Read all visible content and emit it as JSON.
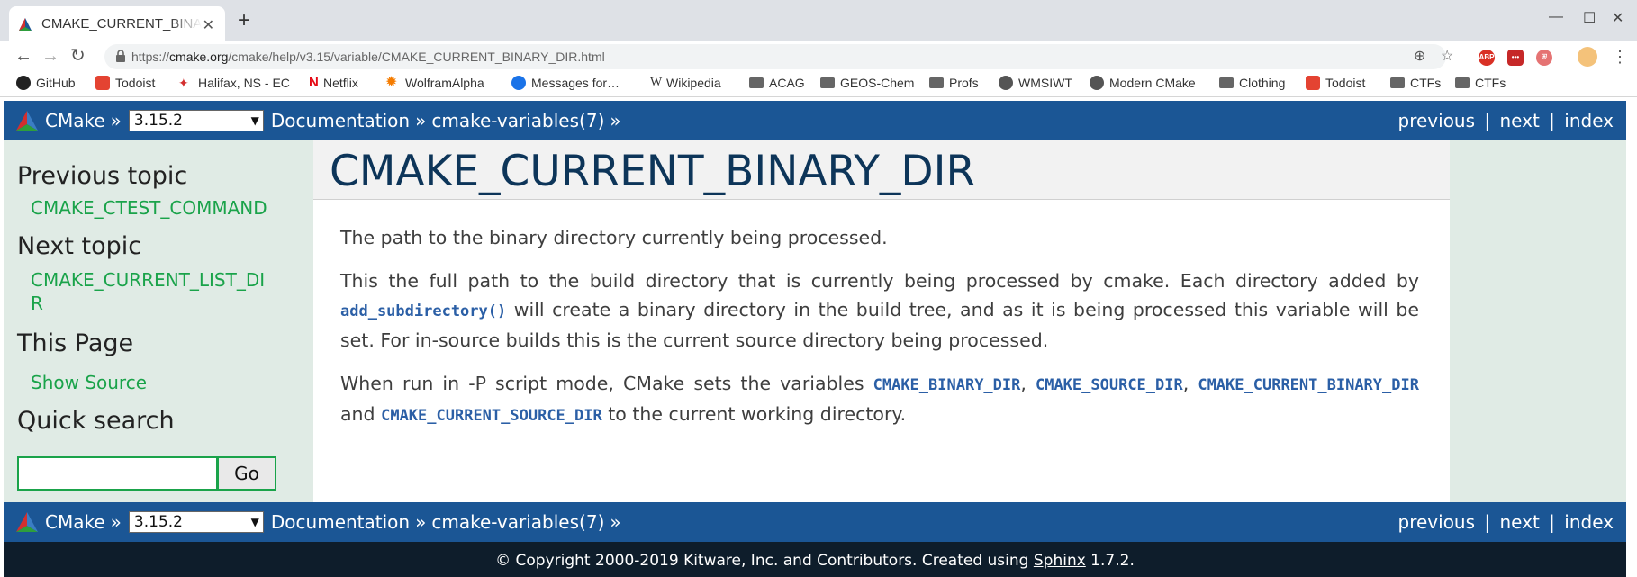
{
  "browser": {
    "tab_title": "CMAKE_CURRENT_BINARY_DIR.html",
    "tab_close": "✕",
    "new_tab": "+",
    "url_scheme": "https://",
    "url_host": "cmake.org",
    "url_path": "/cmake/help/v3.15/variable/CMAKE_CURRENT_BINARY_DIR.html",
    "window_controls": [
      "—",
      "☐",
      "✕"
    ]
  },
  "bookmarks": [
    {
      "label": "GitHub",
      "icon": "github-icon"
    },
    {
      "label": "Todoist",
      "icon": "todoist-icon"
    },
    {
      "label": "Halifax, NS - EC",
      "icon": "maple-leaf-icon"
    },
    {
      "label": "Netflix",
      "icon": "netflix-icon"
    },
    {
      "label": "WolframAlpha",
      "icon": "wolfram-icon"
    },
    {
      "label": "Messages for…",
      "icon": "messages-icon"
    },
    {
      "label": "Wikipedia",
      "icon": "wikipedia-icon"
    },
    {
      "label": "ACAG",
      "icon": "folder-icon"
    },
    {
      "label": "GEOS-Chem",
      "icon": "folder-icon"
    },
    {
      "label": "Profs",
      "icon": "folder-icon"
    },
    {
      "label": "WMSIWT",
      "icon": "globe-icon"
    },
    {
      "label": "Modern CMake",
      "icon": "globe-icon"
    },
    {
      "label": "Clothing",
      "icon": "folder-icon"
    },
    {
      "label": "Todoist",
      "icon": "todoist-icon"
    },
    {
      "label": "CTFs",
      "icon": "folder-icon"
    },
    {
      "label": "CTFs",
      "icon": "folder-icon"
    }
  ],
  "nav": {
    "home": "CMake",
    "sep": "»",
    "version": "3.15.2",
    "documentation": "Documentation",
    "section": "cmake-variables(7)",
    "previous": "previous",
    "next": "next",
    "index": "index",
    "pipe": "|"
  },
  "sidebar": {
    "prev_heading": "Previous topic",
    "prev_link": "CMAKE_CTEST_COMMAND",
    "next_heading": "Next topic",
    "next_link_line1": "CMAKE_CURRENT_LIST_DI",
    "next_link_line2": "R",
    "this_page_heading": "This Page",
    "show_source": "Show Source",
    "search_heading": "Quick search",
    "search_button": "Go",
    "search_value": ""
  },
  "content": {
    "title": "CMAKE_CURRENT_BINARY_DIR",
    "p1": "The path to the binary directory currently being processed.",
    "p2_a": "This the full path to the build directory that is currently being processed by cmake. Each directory added by ",
    "p2_code": "add_subdirectory()",
    "p2_b": " will create a binary directory in the build tree, and as it is being processed this variable will be set. For in-source builds this is the current source directory being processed.",
    "p3_a": "When run in -P script mode, CMake sets the variables ",
    "p3_code1": "CMAKE_BINARY_DIR",
    "p3_sep1": ", ",
    "p3_code2": "CMAKE_SOURCE_DIR",
    "p3_sep2": ", ",
    "p3_code3": "CMAKE_CURRENT_BINARY_DIR",
    "p3_and": " and ",
    "p3_code4": "CMAKE_CURRENT_SOURCE_DIR",
    "p3_b": " to the current working directory."
  },
  "footer": {
    "text_a": "© Copyright 2000-2019 Kitware, Inc. and Contributors. Created using ",
    "sphinx": "Sphinx",
    "text_b": " 1.7.2."
  },
  "colors": {
    "navbar": "#1b5695",
    "sidebar_bg": "#e0ebe5",
    "link_green": "#1aa34a",
    "title": "#0d3559",
    "footer": "#0e1d2b"
  }
}
